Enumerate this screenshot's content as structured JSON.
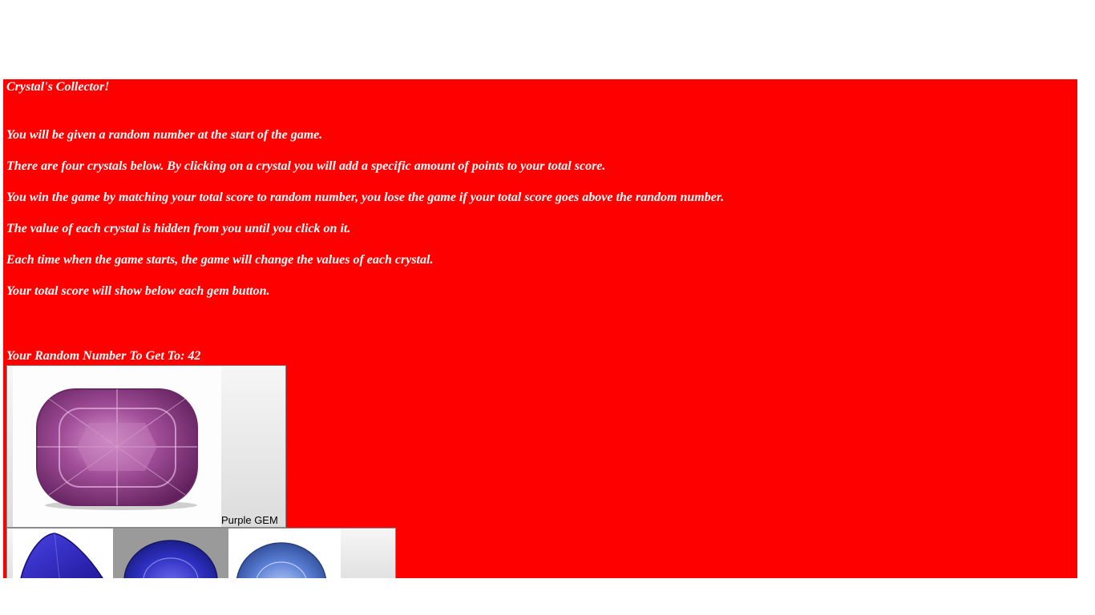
{
  "game": {
    "title": "Crystal's Collector!",
    "instructions": [
      "You will be given a random number at the start of the game.",
      "There are four crystals below. By clicking on a crystal you will add a specific amount of points to your total score.",
      "You win the game by matching your total score to random number, you lose the game if your total score goes above the random number.",
      "The value of each crystal is hidden from you until you click on it.",
      "Each time when the game starts, the game will change the values of each crystal.",
      "Your total score will show below each gem button."
    ],
    "random_number_label": "Your Random Number To Get To: 42"
  },
  "gems": {
    "purple": {
      "label": "Purple GEM",
      "color": "#b05aa8"
    },
    "blue_trillion": {
      "color": "#2a1fc9"
    },
    "blue_round": {
      "color": "#2d2fbf"
    },
    "light_blue": {
      "color": "#5c7fd6"
    }
  },
  "colors": {
    "panel": "#ff0000",
    "text": "#ffffff"
  }
}
